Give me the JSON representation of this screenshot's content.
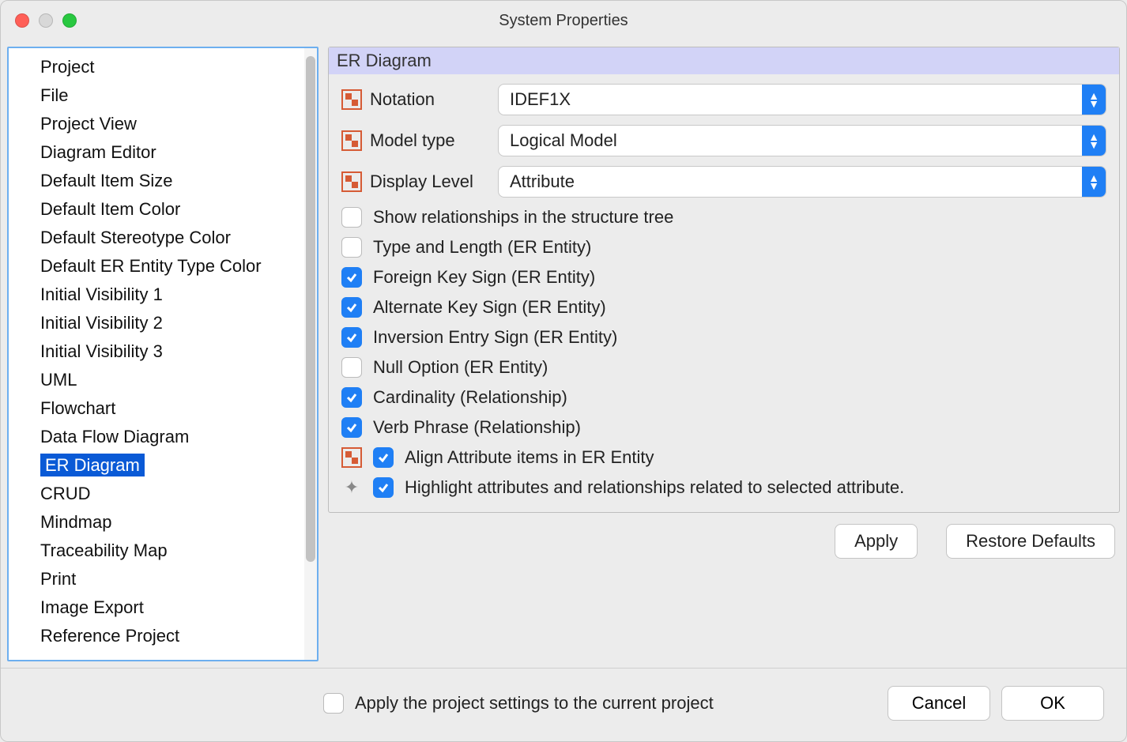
{
  "window": {
    "title": "System Properties"
  },
  "sidebar": {
    "items": [
      "Project",
      "File",
      "Project View",
      "Diagram Editor",
      "Default Item Size",
      "Default Item Color",
      "Default Stereotype Color",
      "Default ER Entity Type Color",
      "Initial Visibility 1",
      "Initial Visibility 2",
      "Initial Visibility 3",
      "UML",
      "Flowchart",
      "Data Flow Diagram",
      "ER Diagram",
      "CRUD",
      "Mindmap",
      "Traceability Map",
      "Print",
      "Image Export",
      "Reference Project"
    ],
    "selected_index": 14
  },
  "panel": {
    "title": "ER Diagram",
    "selects": [
      {
        "label": "Notation",
        "value": "IDEF1X"
      },
      {
        "label": "Model type",
        "value": "Logical Model"
      },
      {
        "label": "Display Level",
        "value": "Attribute"
      }
    ],
    "checkboxes": [
      {
        "label": "Show relationships in the structure tree",
        "checked": false,
        "icon": null
      },
      {
        "label": "Type and Length (ER Entity)",
        "checked": false,
        "icon": null
      },
      {
        "label": "Foreign Key Sign (ER Entity)",
        "checked": true,
        "icon": null
      },
      {
        "label": "Alternate Key Sign (ER Entity)",
        "checked": true,
        "icon": null
      },
      {
        "label": "Inversion Entry Sign (ER Entity)",
        "checked": true,
        "icon": null
      },
      {
        "label": "Null Option (ER Entity)",
        "checked": false,
        "icon": null
      },
      {
        "label": "Cardinality (Relationship)",
        "checked": true,
        "icon": null
      },
      {
        "label": "Verb Phrase (Relationship)",
        "checked": true,
        "icon": null
      },
      {
        "label": "Align Attribute items in ER Entity",
        "checked": true,
        "icon": "box"
      },
      {
        "label": "Highlight attributes and relationships related to selected attribute.",
        "checked": true,
        "icon": "sparkle"
      }
    ],
    "buttons": {
      "apply": "Apply",
      "restore": "Restore Defaults"
    }
  },
  "footer": {
    "apply_project_label": "Apply the project settings to the current project",
    "apply_project_checked": false,
    "cancel": "Cancel",
    "ok": "OK"
  }
}
